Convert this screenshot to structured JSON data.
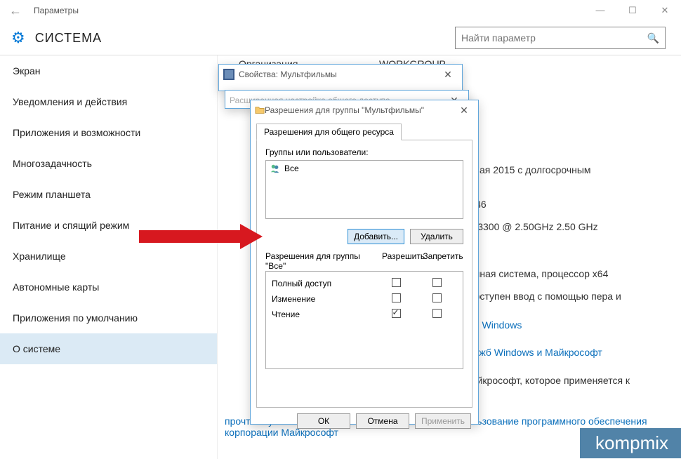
{
  "titlebar": {
    "title": "Параметры"
  },
  "header": {
    "heading": "СИСТЕМА",
    "search_placeholder": "Найти параметр"
  },
  "sidebar": {
    "items": [
      {
        "label": "Экран"
      },
      {
        "label": "Уведомления и действия"
      },
      {
        "label": "Приложения и возможности"
      },
      {
        "label": "Многозадачность"
      },
      {
        "label": "Режим планшета"
      },
      {
        "label": "Питание и спящий режим"
      },
      {
        "label": "Хранилище"
      },
      {
        "label": "Автономные карты"
      },
      {
        "label": "Приложения по умолчанию"
      },
      {
        "label": "О системе"
      }
    ],
    "selected": 9
  },
  "main": {
    "org_label": "Организация",
    "org_value": "WORKGROUP",
    "frag_edition": "ивная 2015 с долгосрочным",
    "frag_model": "A146",
    "frag_cpu": "J      E3300  @ 2.50GHz  2.50 GHz",
    "frag_os": "ионная система, процессор x64",
    "frag_pen": "едоступен ввод с помощью пера и",
    "link_windows": "сии Windows",
    "link_services": "служб Windows и Майкрософт",
    "frag_ms1": "Майкрософт, которое применяется к",
    "link_license": "прочтите условия лицензионного соглашения на использование программного обеспечения корпорации Майкрософт"
  },
  "dlg1": {
    "title": "Свойства: Мультфильмы"
  },
  "dlg2": {
    "title": "Расширенная настройка общего доступа"
  },
  "dlg3": {
    "title": "Разрешения для группы \"Мультфильмы\"",
    "tab": "Разрешения для общего ресурса",
    "groups_label": "Группы или пользователи:",
    "group_everyone": "Все",
    "btn_add": "Добавить...",
    "btn_remove": "Удалить",
    "perm_heading": "Разрешения для группы \"Все\"",
    "col_allow": "Разрешить",
    "col_deny": "Запретить",
    "perms": [
      {
        "name": "Полный доступ",
        "allow": false,
        "deny": false
      },
      {
        "name": "Изменение",
        "allow": false,
        "deny": false
      },
      {
        "name": "Чтение",
        "allow": true,
        "deny": false
      }
    ],
    "ok": "ОК",
    "cancel": "Отмена",
    "apply": "Применить"
  },
  "watermark": "kompmix"
}
